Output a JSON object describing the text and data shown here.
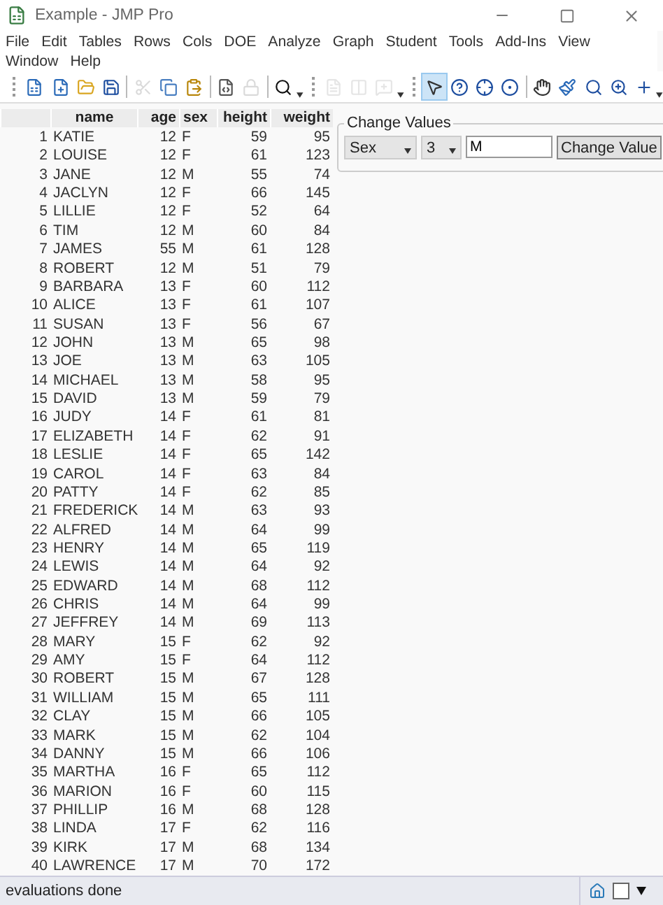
{
  "window": {
    "title": "Example - JMP Pro"
  },
  "menu": [
    "File",
    "Edit",
    "Tables",
    "Rows",
    "Cols",
    "DOE",
    "Analyze",
    "Graph",
    "Student",
    "Tools",
    "Add-Ins",
    "View",
    "Window",
    "Help"
  ],
  "toolbar": [
    {
      "kind": "button",
      "disabled": false,
      "selected": false
    },
    {
      "kind": "button",
      "disabled": false,
      "selected": false
    },
    {
      "kind": "button",
      "disabled": false,
      "selected": false
    },
    {
      "kind": "button",
      "disabled": false,
      "selected": false
    },
    {
      "kind": "separator"
    },
    {
      "kind": "button",
      "disabled": true,
      "selected": false
    },
    {
      "kind": "button",
      "disabled": false,
      "selected": false
    },
    {
      "kind": "button",
      "disabled": false,
      "selected": false
    },
    {
      "kind": "separator"
    },
    {
      "kind": "button",
      "disabled": false,
      "selected": false
    },
    {
      "kind": "button",
      "disabled": true,
      "selected": false
    },
    {
      "kind": "separator"
    },
    {
      "kind": "button",
      "disabled": false,
      "selected": false
    },
    {
      "kind": "overflow"
    },
    {
      "kind": "grip"
    },
    {
      "kind": "button",
      "disabled": true,
      "selected": false
    },
    {
      "kind": "button",
      "disabled": true,
      "selected": false
    },
    {
      "kind": "button",
      "disabled": true,
      "selected": false
    },
    {
      "kind": "overflow"
    },
    {
      "kind": "grip"
    },
    {
      "kind": "button",
      "disabled": false,
      "selected": true
    },
    {
      "kind": "button",
      "disabled": false,
      "selected": false
    },
    {
      "kind": "button",
      "disabled": false,
      "selected": false
    },
    {
      "kind": "button",
      "disabled": false,
      "selected": false
    },
    {
      "kind": "separator"
    },
    {
      "kind": "button",
      "disabled": false,
      "selected": false
    },
    {
      "kind": "button",
      "disabled": false,
      "selected": false
    },
    {
      "kind": "button",
      "disabled": false,
      "selected": false
    },
    {
      "kind": "button",
      "disabled": false,
      "selected": false
    },
    {
      "kind": "button",
      "disabled": false,
      "selected": false
    },
    {
      "kind": "overflow"
    }
  ],
  "table": {
    "columns": [
      "",
      "name",
      "age",
      "sex",
      "height",
      "weight"
    ],
    "rows": [
      [
        "1",
        "KATIE",
        "12",
        "F",
        "59",
        "95"
      ],
      [
        "2",
        "LOUISE",
        "12",
        "F",
        "61",
        "123"
      ],
      [
        "3",
        "JANE",
        "12",
        "M",
        "55",
        "74"
      ],
      [
        "4",
        "JACLYN",
        "12",
        "F",
        "66",
        "145"
      ],
      [
        "5",
        "LILLIE",
        "12",
        "F",
        "52",
        "64"
      ],
      [
        "6",
        "TIM",
        "12",
        "M",
        "60",
        "84"
      ],
      [
        "7",
        "JAMES",
        "55",
        "M",
        "61",
        "128"
      ],
      [
        "8",
        "ROBERT",
        "12",
        "M",
        "51",
        "79"
      ],
      [
        "9",
        "BARBARA",
        "13",
        "F",
        "60",
        "112"
      ],
      [
        "10",
        "ALICE",
        "13",
        "F",
        "61",
        "107"
      ],
      [
        "11",
        "SUSAN",
        "13",
        "F",
        "56",
        "67"
      ],
      [
        "12",
        "JOHN",
        "13",
        "M",
        "65",
        "98"
      ],
      [
        "13",
        "JOE",
        "13",
        "M",
        "63",
        "105"
      ],
      [
        "14",
        "MICHAEL",
        "13",
        "M",
        "58",
        "95"
      ],
      [
        "15",
        "DAVID",
        "13",
        "M",
        "59",
        "79"
      ],
      [
        "16",
        "JUDY",
        "14",
        "F",
        "61",
        "81"
      ],
      [
        "17",
        "ELIZABETH",
        "14",
        "F",
        "62",
        "91"
      ],
      [
        "18",
        "LESLIE",
        "14",
        "F",
        "65",
        "142"
      ],
      [
        "19",
        "CAROL",
        "14",
        "F",
        "63",
        "84"
      ],
      [
        "20",
        "PATTY",
        "14",
        "F",
        "62",
        "85"
      ],
      [
        "21",
        "FREDERICK",
        "14",
        "M",
        "63",
        "93"
      ],
      [
        "22",
        "ALFRED",
        "14",
        "M",
        "64",
        "99"
      ],
      [
        "23",
        "HENRY",
        "14",
        "M",
        "65",
        "119"
      ],
      [
        "24",
        "LEWIS",
        "14",
        "M",
        "64",
        "92"
      ],
      [
        "25",
        "EDWARD",
        "14",
        "M",
        "68",
        "112"
      ],
      [
        "26",
        "CHRIS",
        "14",
        "M",
        "64",
        "99"
      ],
      [
        "27",
        "JEFFREY",
        "14",
        "M",
        "69",
        "113"
      ],
      [
        "28",
        "MARY",
        "15",
        "F",
        "62",
        "92"
      ],
      [
        "29",
        "AMY",
        "15",
        "F",
        "64",
        "112"
      ],
      [
        "30",
        "ROBERT",
        "15",
        "M",
        "67",
        "128"
      ],
      [
        "31",
        "WILLIAM",
        "15",
        "M",
        "65",
        "111"
      ],
      [
        "32",
        "CLAY",
        "15",
        "M",
        "66",
        "105"
      ],
      [
        "33",
        "MARK",
        "15",
        "M",
        "62",
        "104"
      ],
      [
        "34",
        "DANNY",
        "15",
        "M",
        "66",
        "106"
      ],
      [
        "35",
        "MARTHA",
        "16",
        "F",
        "65",
        "112"
      ],
      [
        "36",
        "MARION",
        "16",
        "F",
        "60",
        "115"
      ],
      [
        "37",
        "PHILLIP",
        "16",
        "M",
        "68",
        "128"
      ],
      [
        "38",
        "LINDA",
        "17",
        "F",
        "62",
        "116"
      ],
      [
        "39",
        "KIRK",
        "17",
        "M",
        "68",
        "134"
      ],
      [
        "40",
        "LAWRENCE",
        "17",
        "M",
        "70",
        "172"
      ]
    ]
  },
  "change_values": {
    "title": "Change Values",
    "column_select": "Sex",
    "row_select": "3",
    "value": "M",
    "button": "Change Value"
  },
  "status_bar": {
    "text": "evaluations done"
  }
}
